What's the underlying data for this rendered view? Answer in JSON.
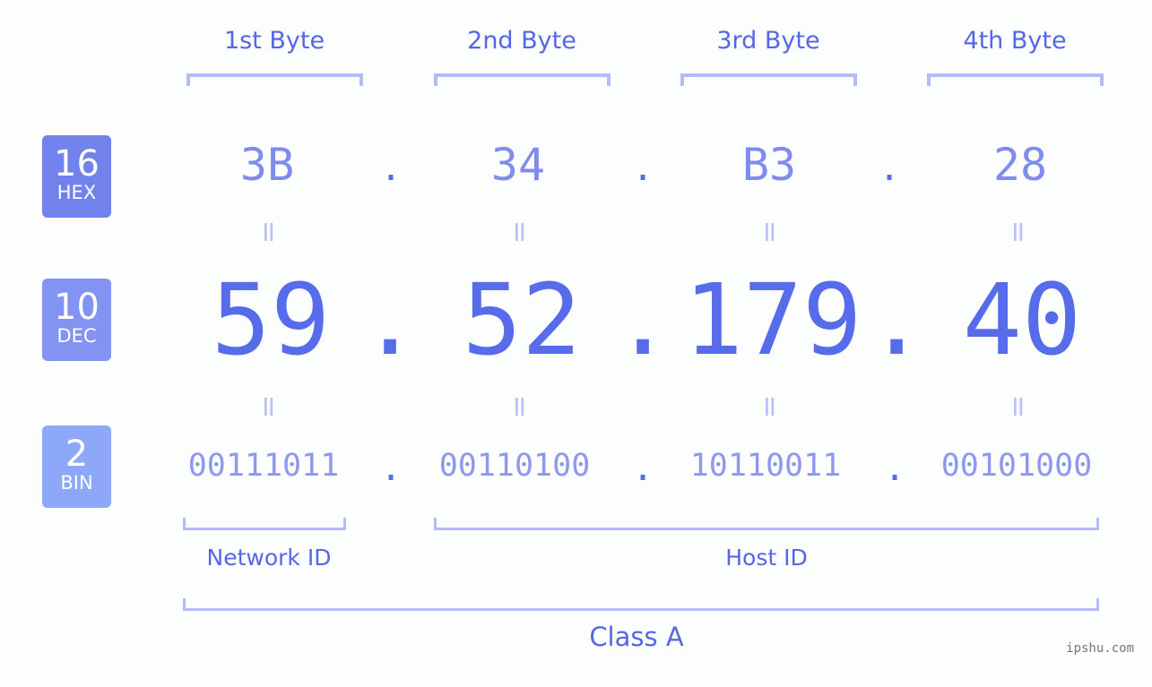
{
  "bytes": [
    {
      "label": "1st Byte",
      "hex": "3B",
      "dec": "59",
      "bin": "00111011"
    },
    {
      "label": "2nd Byte",
      "hex": "34",
      "dec": "52",
      "bin": "00110100"
    },
    {
      "label": "3rd Byte",
      "hex": "B3",
      "dec": "179",
      "bin": "10110011"
    },
    {
      "label": "4th Byte",
      "hex": "28",
      "dec": "40",
      "bin": "00101000"
    }
  ],
  "rows": {
    "hex": {
      "base": "16",
      "name": "HEX",
      "color": "#7282ec"
    },
    "dec": {
      "base": "10",
      "name": "DEC",
      "color": "#8293f1"
    },
    "bin": {
      "base": "2",
      "name": "BIN",
      "color": "#8da8f8"
    }
  },
  "separator": ".",
  "equals": "=",
  "groups": {
    "network": "Network ID",
    "host": "Host ID",
    "class": "Class A"
  },
  "watermark": "ipshu.com"
}
